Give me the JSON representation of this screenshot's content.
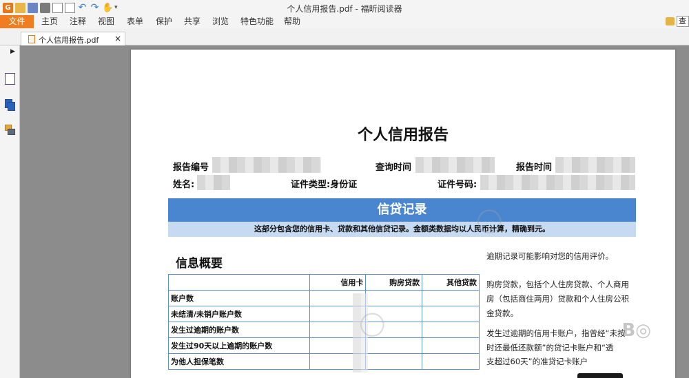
{
  "window": {
    "title": "个人信用报告.pdf - 福昕阅读器"
  },
  "menu": {
    "file": "文件",
    "items": [
      "主页",
      "注释",
      "视图",
      "表单",
      "保护",
      "共享",
      "浏览",
      "特色功能",
      "帮助"
    ]
  },
  "search": {
    "label": "查"
  },
  "tab": {
    "label": "个人信用报告.pdf",
    "close": "×"
  },
  "sidebar": {
    "expand": "▶"
  },
  "document": {
    "title": "个人信用报告",
    "fields": {
      "report_no_label": "报告编号",
      "query_time_label": "查询时间",
      "report_time_label": "报告时间",
      "name_label": "姓名:",
      "id_type": "证件类型:身份证",
      "id_no_label": "证件号码:"
    },
    "banner": "信贷记录",
    "subbanner": "这部分包含您的信用卡、贷款和其他信贷记录。金额类数据均以人民币计算，精确到元。",
    "section_title": "信息概要",
    "table": {
      "headers": [
        "",
        "信用卡",
        "购房贷款",
        "其他贷款"
      ],
      "rows": [
        "账户数",
        " 未结清/未销户账户数",
        "发生过逾期的账户数",
        " 发生过90天以上逾期的账户数",
        "为他人担保笔数"
      ]
    },
    "right_notes": {
      "p1": "逾期记录可能影响对您的信用评价。",
      "p2_l1": "购房贷款，包括个人住房贷款、个人商用",
      "p2_l2": "房（包括商住两用）贷款和个人住房公积",
      "p2_l3": "金贷款。",
      "p3_l1": "发生过逾期的信用卡账户，指曾经“未按",
      "p3_l2": "时还最低还款额”的贷记卡账户和“透",
      "p3_l3": "支超过60天”的准贷记卡账户"
    }
  }
}
